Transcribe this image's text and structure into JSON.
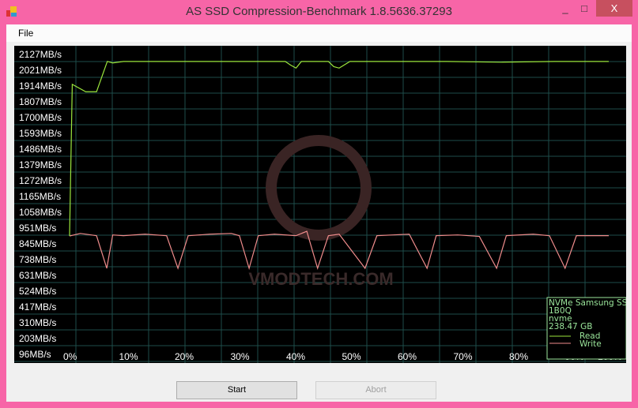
{
  "window": {
    "title": "AS SSD Compression-Benchmark 1.8.5636.37293",
    "minimize": "_",
    "maximize": "□",
    "close": "X"
  },
  "menu": {
    "file": "File"
  },
  "watermark": "VMODTECH.COM",
  "buttons": {
    "start": "Start",
    "abort": "Abort"
  },
  "legend": {
    "device": "NVMe Samsung SS",
    "firmware": "1B0Q",
    "driver": "nvme",
    "size": "238.47 GB",
    "read": "Read",
    "write": "Write"
  },
  "colors": {
    "read": "#9be63c",
    "write": "#f08c8c",
    "grid": "#1e4d4a",
    "legend_text": "#9be69b"
  },
  "chart_data": {
    "type": "line",
    "ylabels": [
      "2127MB/s",
      "2021MB/s",
      "1914MB/s",
      "1807MB/s",
      "1700MB/s",
      "1593MB/s",
      "1486MB/s",
      "1379MB/s",
      "1272MB/s",
      "1165MB/s",
      "1058MB/s",
      "951MB/s",
      "845MB/s",
      "738MB/s",
      "631MB/s",
      "524MB/s",
      "417MB/s",
      "310MB/s",
      "203MB/s",
      "96MB/s"
    ],
    "xlabels": [
      "0%",
      "10%",
      "20%",
      "30%",
      "40%",
      "50%",
      "60%",
      "70%",
      "80%",
      "90%",
      "100%"
    ],
    "ylim": [
      96,
      2127
    ],
    "xlim": [
      0,
      100
    ],
    "series": [
      {
        "name": "Read",
        "x": [
          0,
          0.5,
          3,
          5,
          7,
          8,
          10,
          20,
          30,
          40,
          41,
          42,
          43,
          46,
          48,
          49,
          50,
          52,
          60,
          70,
          80,
          90,
          100
        ],
        "values": [
          903,
          1930,
          1880,
          1880,
          2085,
          2075,
          2085,
          2085,
          2085,
          2085,
          2060,
          2040,
          2085,
          2085,
          2085,
          2050,
          2040,
          2085,
          2085,
          2085,
          2080,
          2085,
          2085
        ]
      },
      {
        "name": "Write",
        "x": [
          0,
          2,
          4,
          5,
          6.9,
          8,
          10,
          14,
          18,
          20.1,
          22,
          26,
          30,
          31.5,
          33.3,
          35,
          38,
          42,
          44,
          46,
          48,
          50,
          54.8,
          57,
          60,
          63,
          66.3,
          68,
          72,
          76,
          79.2,
          81,
          86,
          89,
          91.9,
          94,
          98,
          100
        ],
        "values": [
          903,
          920,
          910,
          905,
          684,
          910,
          905,
          915,
          905,
          684,
          905,
          915,
          920,
          905,
          684,
          905,
          915,
          905,
          935,
          684,
          905,
          915,
          684,
          905,
          910,
          915,
          684,
          905,
          910,
          900,
          684,
          905,
          915,
          905,
          684,
          905,
          905,
          905
        ]
      }
    ]
  }
}
